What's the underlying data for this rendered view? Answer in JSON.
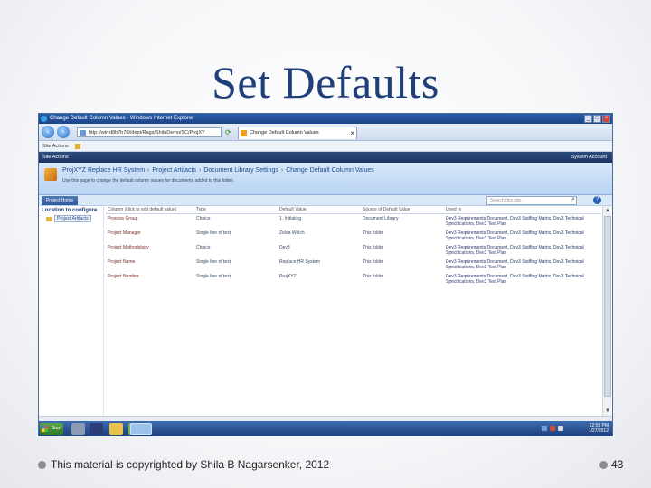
{
  "slide": {
    "title": "Set Defaults",
    "footer": "This material is copyrighted by Shila B Nagarsenker, 2012",
    "page_number": "43"
  },
  "browser": {
    "window_title": "Change Default Column Values - Windows Internet Explorer",
    "address": "http://wtr-d8b7b7f9/dept/Rags/ShilaDemo/SC/ProjXY",
    "tab_title": "Change Default Column Values",
    "command_item": "Site Actions",
    "user": "System Account"
  },
  "sharepoint": {
    "breadcrumb": [
      "ProjXYZ Replace HR System",
      "Project Artifacts",
      "Document Library Settings",
      "Change Default Column Values"
    ],
    "subtitle": "Use this page to change the default column values for documents added to this folder.",
    "nav_button": "Project Home",
    "search_placeholder": "Search this site...",
    "left_header": "Location to configure",
    "left_node": "Project Artifacts"
  },
  "grid": {
    "headers": [
      "Column (click to edit default value)",
      "Type",
      "Default Value",
      "Source of Default Value",
      "Used In"
    ],
    "rows": [
      {
        "column": "Process Group",
        "type": "Choice",
        "default": "1. Initiating",
        "source": "Document Library",
        "used": "Dev3 Requirements Document, Dev3 Staffing Matrix, Dev3 Technical Specifications, Dev3 Test Plan"
      },
      {
        "column": "Project Manager",
        "type": "Single line of text",
        "default": "Zelda Welch",
        "source": "This folder",
        "used": "Dev3 Requirements Document, Dev3 Staffing Matrix, Dev3 Technical Specifications, Dev3 Test Plan"
      },
      {
        "column": "Project Methodology",
        "type": "Choice",
        "default": "Dev3",
        "source": "This folder",
        "used": "Dev3 Requirements Document, Dev3 Staffing Matrix, Dev3 Technical Specifications, Dev3 Test Plan"
      },
      {
        "column": "Project Name",
        "type": "Single line of text",
        "default": "Replace HR System",
        "source": "This folder",
        "used": "Dev3 Requirements Document, Dev3 Staffing Matrix, Dev3 Technical Specifications, Dev3 Test Plan"
      },
      {
        "column": "Project Number",
        "type": "Single line of text",
        "default": "ProjXYZ",
        "source": "This folder",
        "used": "Dev3 Requirements Document, Dev3 Staffing Matrix, Dev3 Technical Specifications, Dev3 Test Plan"
      }
    ]
  },
  "taskbar": {
    "start_label": "Start",
    "time": "12:59 PM",
    "date": "1/27/2012"
  },
  "colors": {
    "title": "#1f3f7a",
    "sp_header": "#1b3563",
    "taskbar": "#1e3f7a"
  }
}
